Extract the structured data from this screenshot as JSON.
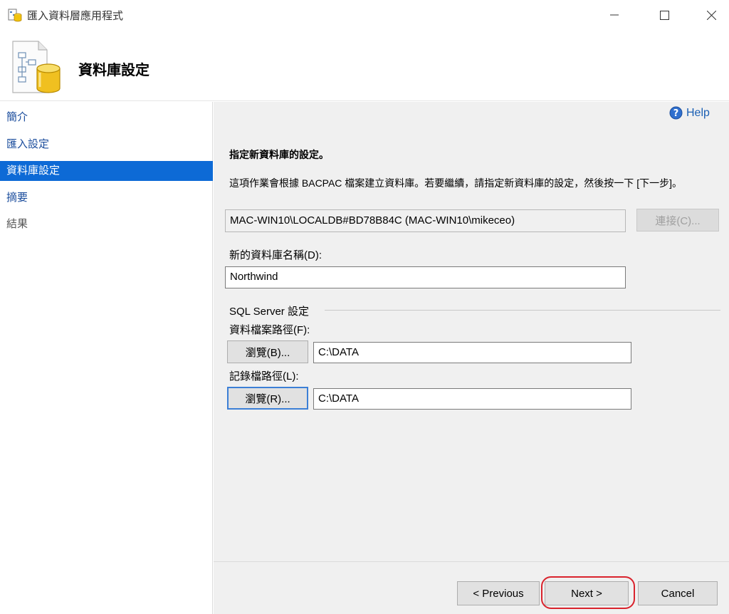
{
  "window": {
    "title": "匯入資料層應用程式",
    "controls": {
      "minimize_icon": "minimize-icon",
      "maximize_icon": "maximize-icon",
      "close_icon": "close-icon"
    }
  },
  "header": {
    "title": "資料庫設定"
  },
  "sidebar": {
    "items": [
      {
        "label": "簡介",
        "state": "link"
      },
      {
        "label": "匯入設定",
        "state": "link"
      },
      {
        "label": "資料庫設定",
        "state": "active"
      },
      {
        "label": "摘要",
        "state": "link"
      },
      {
        "label": "結果",
        "state": "disabled"
      }
    ]
  },
  "main": {
    "help_label": "Help",
    "section_title": "指定新資料庫的設定。",
    "description": "這項作業會根據 BACPAC 檔案建立資料庫。若要繼續，請指定新資料庫的設定，然後按一下 [下一步]。",
    "server": {
      "value": "MAC-WIN10\\LOCALDB#BD78B84C (MAC-WIN10\\mikeceo)",
      "connect_label": "連接(C)..."
    },
    "database_name": {
      "label": "新的資料庫名稱(D):",
      "value": "Northwind"
    },
    "sql_server_group": {
      "title": "SQL Server 設定",
      "data_file": {
        "label": "資料檔案路徑(F):",
        "browse_label": "瀏覽(B)...",
        "value": "C:\\DATA"
      },
      "log_file": {
        "label": "記錄檔路徑(L):",
        "browse_label": "瀏覽(R)...",
        "value": "C:\\DATA"
      }
    }
  },
  "footer": {
    "previous_label": "< Previous",
    "next_label": "Next >",
    "cancel_label": "Cancel"
  },
  "colors": {
    "accent": "#0d6ad6",
    "link": "#1a4c9c",
    "highlight": "#d9232d"
  }
}
